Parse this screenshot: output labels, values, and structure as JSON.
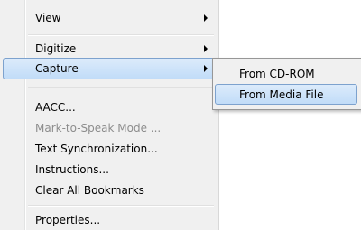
{
  "menu": {
    "items": [
      {
        "label": "View",
        "has_submenu": true
      },
      {
        "label": "Digitize",
        "has_submenu": true
      },
      {
        "label": "Capture",
        "has_submenu": true,
        "highlighted": true
      },
      {
        "label": "AACC..."
      },
      {
        "label": "Mark-to-Speak Mode ...",
        "disabled": true
      },
      {
        "label": "Text Synchronization..."
      },
      {
        "label": "Instructions..."
      },
      {
        "label": "Clear All Bookmarks"
      },
      {
        "label": "Properties..."
      }
    ]
  },
  "submenu": {
    "items": [
      {
        "label": "From CD-ROM"
      },
      {
        "label": "From Media File",
        "highlighted": true
      }
    ]
  },
  "colors": {
    "menu_background": "#f0f0f0",
    "highlight_border": "#7da2ce",
    "highlight_fill": "#c1dcf8",
    "disabled_text": "#8d8d8d"
  }
}
